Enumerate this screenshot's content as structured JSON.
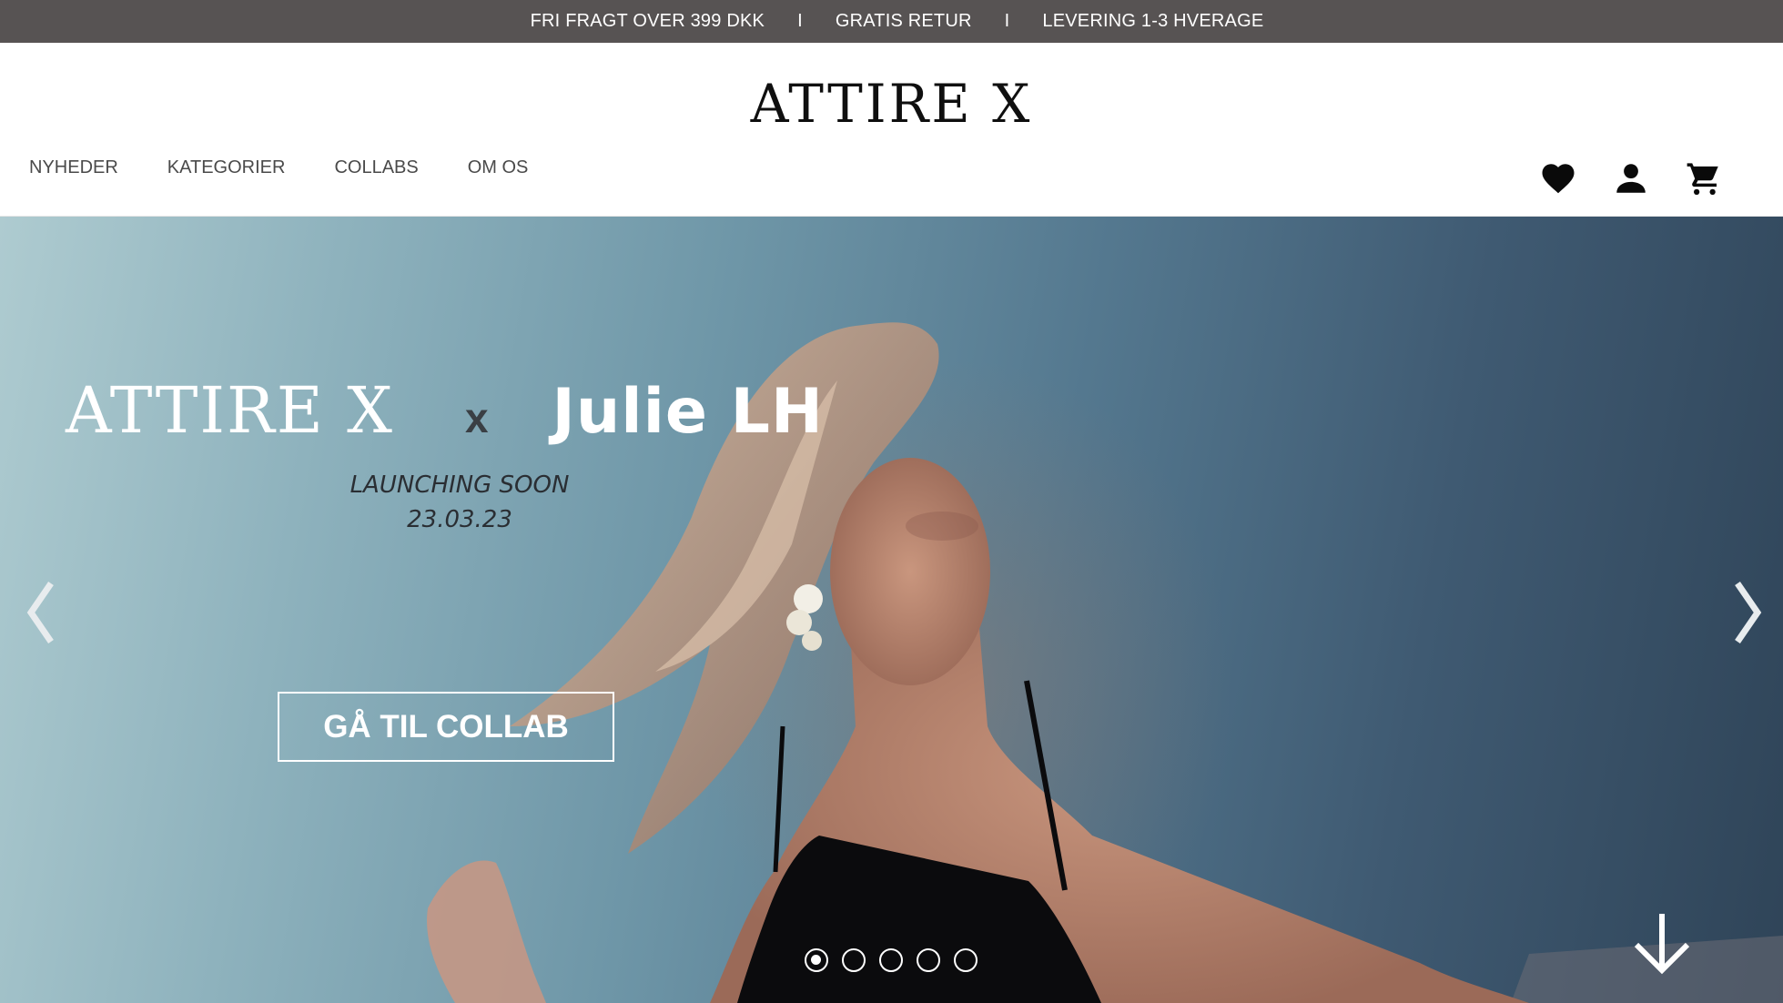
{
  "announcement": {
    "messages": [
      "FRI FRAGT OVER 399 DKK",
      "GRATIS RETUR",
      "LEVERING 1-3 HVERAGE"
    ],
    "separator": "I"
  },
  "header": {
    "logo": "ATTIRE X",
    "nav": [
      "NYHEDER",
      "KATEGORIER",
      "COLLABS",
      "OM OS"
    ],
    "icons": [
      "heart-icon",
      "account-icon",
      "cart-icon"
    ]
  },
  "hero": {
    "brand": "ATTIRE X",
    "x": "x",
    "collab_name": "Julie LH",
    "subtitle_line1": "LAUNCHING SOON",
    "subtitle_line2": "23.03.23",
    "cta_label": "GÅ TIL COLLAB",
    "slide_count": 5,
    "active_slide": 1,
    "icons": [
      "chevron-left-icon",
      "chevron-right-icon",
      "arrow-down-icon"
    ]
  },
  "colors": {
    "announcement_bg": "#575353",
    "text_dark": "#0f0f0f",
    "nav_text": "#4a4a4a",
    "hero_text": "#ffffff"
  }
}
